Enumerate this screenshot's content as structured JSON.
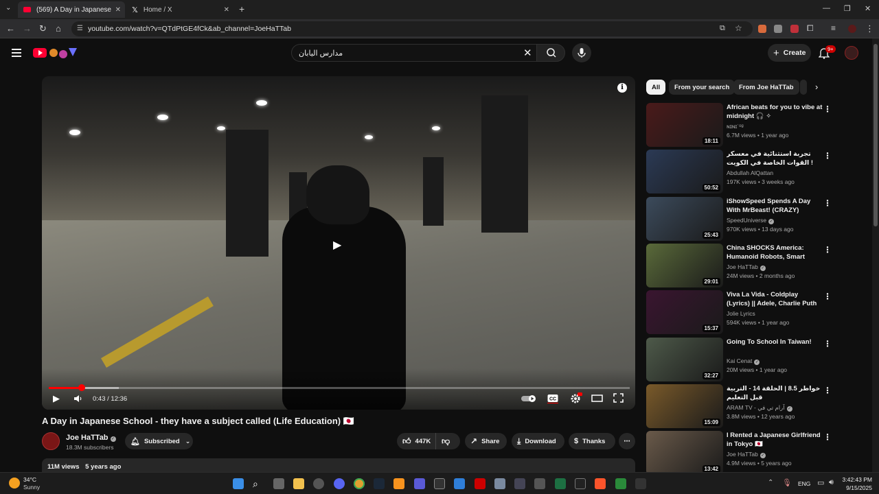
{
  "browser": {
    "tabs": [
      {
        "title": "(569) A Day in Japanese School -",
        "active": true
      },
      {
        "title": "Home / X",
        "active": false
      }
    ],
    "url": "youtube.com/watch?v=QTdPtGE4fCk&ab_channel=JoeHaTTab"
  },
  "header": {
    "search_query": "مدارس اليابان",
    "create_label": "Create",
    "notification_badge": "9+"
  },
  "player": {
    "current_time": "0:43",
    "duration": "12:36",
    "time_display": "0:43 / 12:36",
    "progress_fraction": 0.057,
    "buffered_fraction": 0.12,
    "autoplay_on": true
  },
  "video": {
    "title": "A Day in Japanese School - they have a subject called (Life Education) 🇯🇵",
    "channel": "Joe HaTTab",
    "subscribers": "18.3M subscribers",
    "subscribed_label": "Subscribed",
    "likes": "447K",
    "share_label": "Share",
    "download_label": "Download",
    "thanks_label": "Thanks",
    "views": "11M views",
    "age": "5 years ago"
  },
  "chips": [
    "All",
    "From your search",
    "From Joe HaTTab"
  ],
  "recommendations": [
    {
      "title": "African beats for you to vibe at midnight 🎧 ✧",
      "channel": "ɴɪɴɪ˙ᵒᵍ",
      "verified": false,
      "views": "6.7M views",
      "age": "1 year ago",
      "duration": "18:11",
      "thumb_color": "#4a1a1a"
    },
    {
      "title": "تجربة استثنائية في معسكر القوات الخاصة في الكويت !",
      "channel": "Abdullah AlQattan",
      "verified": false,
      "views": "197K views",
      "age": "3 weeks ago",
      "duration": "50:52",
      "thumb_color": "#2b3a55"
    },
    {
      "title": "iShowSpeed Spends A Day With MrBeast! (CRAZY)",
      "channel": "SpeedUniverse",
      "verified": true,
      "views": "970K views",
      "age": "13 days ago",
      "duration": "25:43",
      "thumb_color": "#3c4b5c"
    },
    {
      "title": "China SHOCKS America: Humanoid Robots, Smart Citie...",
      "channel": "Joe HaTTab",
      "verified": true,
      "views": "24M views",
      "age": "2 months ago",
      "duration": "29:01",
      "thumb_color": "#5a6a3a"
    },
    {
      "title": "Viva La Vida - Coldplay (Lyrics) || Adele, Charlie Puth (Mix ...",
      "channel": "Jolie Lyrics",
      "verified": false,
      "views": "594K views",
      "age": "1 year ago",
      "duration": "15:37",
      "thumb_color": "#3a1530"
    },
    {
      "title": "Going To School In Taiwan!",
      "channel": "Kai Cenat",
      "verified": true,
      "views": "20M views",
      "age": "1 year ago",
      "duration": "32:27",
      "thumb_color": "#4e5a4a"
    },
    {
      "title": "خواطر 8.5 | الحلقة 14 - التربية قبل التعليم",
      "channel": "ARAM TV - آرام تي في",
      "verified": true,
      "views": "3.8M views",
      "age": "12 years ago",
      "duration": "15:09",
      "thumb_color": "#7a5a2a"
    },
    {
      "title": "I Rented a Japanese Girlfriend in Tokyo 🇯🇵",
      "channel": "Joe HaTTab",
      "verified": true,
      "views": "4.9M views",
      "age": "5 years ago",
      "duration": "13:42",
      "thumb_color": "#6a5a4a"
    }
  ],
  "taskbar": {
    "temperature": "34°C",
    "weather": "Sunny",
    "language": "ENG",
    "time": "3:42:43 PM",
    "date": "9/15/2025"
  },
  "colors": {
    "accent": "#ff0000",
    "background": "#0f0f0f",
    "surface": "#272727"
  }
}
